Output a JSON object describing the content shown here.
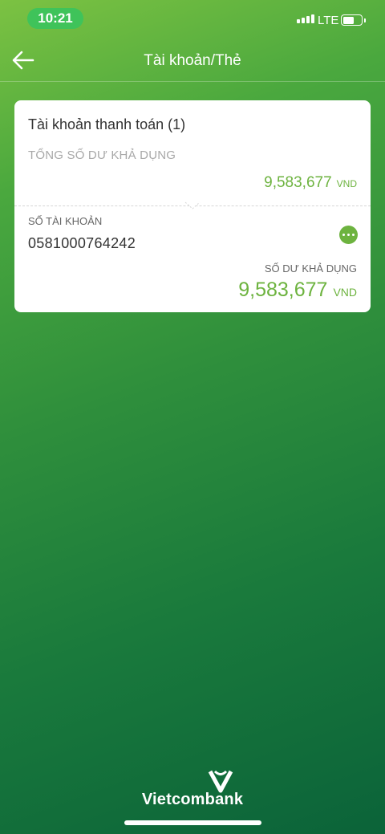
{
  "status_bar": {
    "time": "10:21",
    "network": "LTE",
    "icons": [
      "signal-icon",
      "battery-icon"
    ]
  },
  "header": {
    "title": "Tài khoản/Thẻ",
    "back_icon": "arrow-left-icon"
  },
  "card": {
    "account_type": "Tài khoản thanh toán (1)",
    "total_label": "TỔNG SỐ DƯ KHẢ DỤNG",
    "total_amount": "9,583,677",
    "total_currency": "VND",
    "account_number_label": "SỐ TÀI KHOẢN",
    "account_number": "0581000764242",
    "more_icon": "more-options-icon",
    "balance_label": "SỐ DƯ KHẢ DỤNG",
    "balance_amount": "9,583,677",
    "balance_currency": "VND"
  },
  "footer": {
    "brand": "Vietcombank"
  },
  "colors": {
    "accent": "#6db33f",
    "status_pill": "#3fc35a",
    "bg_top": "#7cc242",
    "bg_bottom": "#0b6339"
  }
}
